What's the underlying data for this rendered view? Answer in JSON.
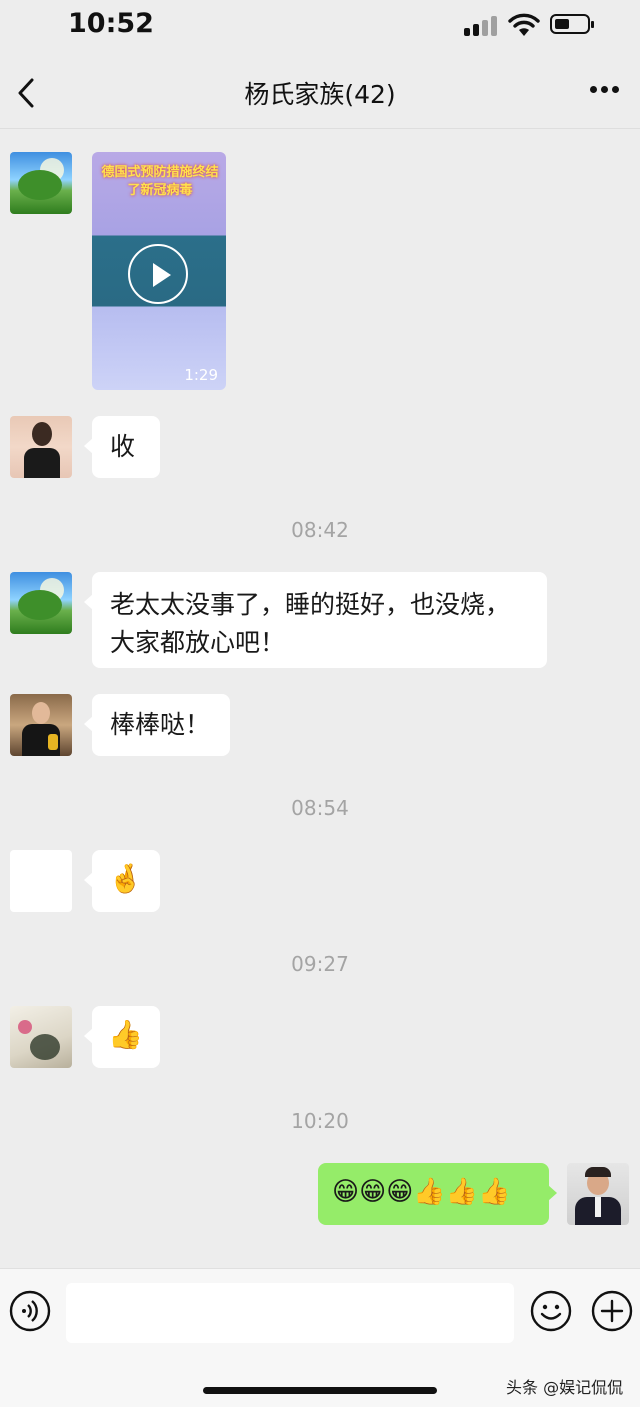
{
  "status_bar": {
    "time": "10:52"
  },
  "nav": {
    "title": "杨氏家族(42)"
  },
  "video_message": {
    "title_text": "德国式预防措施终结了新冠病毒",
    "duration": "1:29"
  },
  "messages": [
    {
      "text": "收"
    },
    {
      "text": "老太太没事了，睡的挺好，也没烧，大家都放心吧！"
    },
    {
      "text": "棒棒哒！"
    }
  ],
  "timestamps": [
    "08:42",
    "08:54",
    "09:27",
    "10:20"
  ],
  "sticker_messages": {
    "fingers_crossed": "🤞",
    "thumbs_up": "👍",
    "mine": "😁😁😁👍👍👍"
  },
  "watermark": "头条 @娱记侃侃",
  "colors": {
    "background": "#ededed",
    "own_bubble": "#95ec69",
    "other_bubble": "#ffffff"
  }
}
